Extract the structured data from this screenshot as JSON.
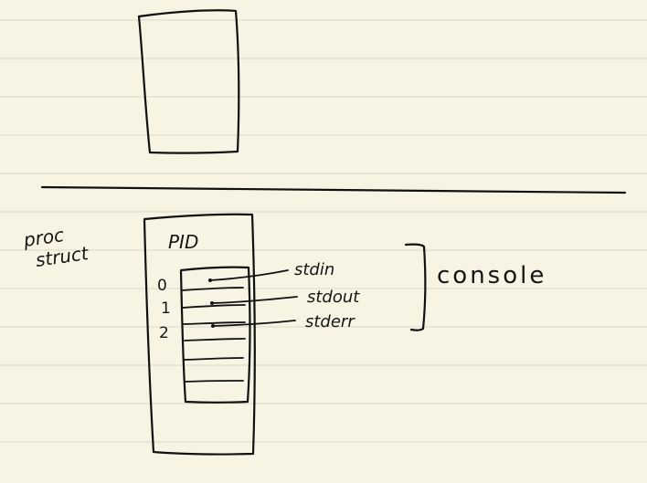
{
  "paper": {
    "background": "#f7f4e4",
    "rule_color": "#dad7ca",
    "ink_color": "#111111"
  },
  "labels": {
    "proc_line1": "proc",
    "proc_line2": "struct",
    "pid": "PID",
    "fd_index_0": "0",
    "fd_index_1": "1",
    "fd_index_2": "2",
    "stdin": "stdin",
    "stdout": "stdout",
    "stderr": "stderr",
    "console": "console"
  }
}
